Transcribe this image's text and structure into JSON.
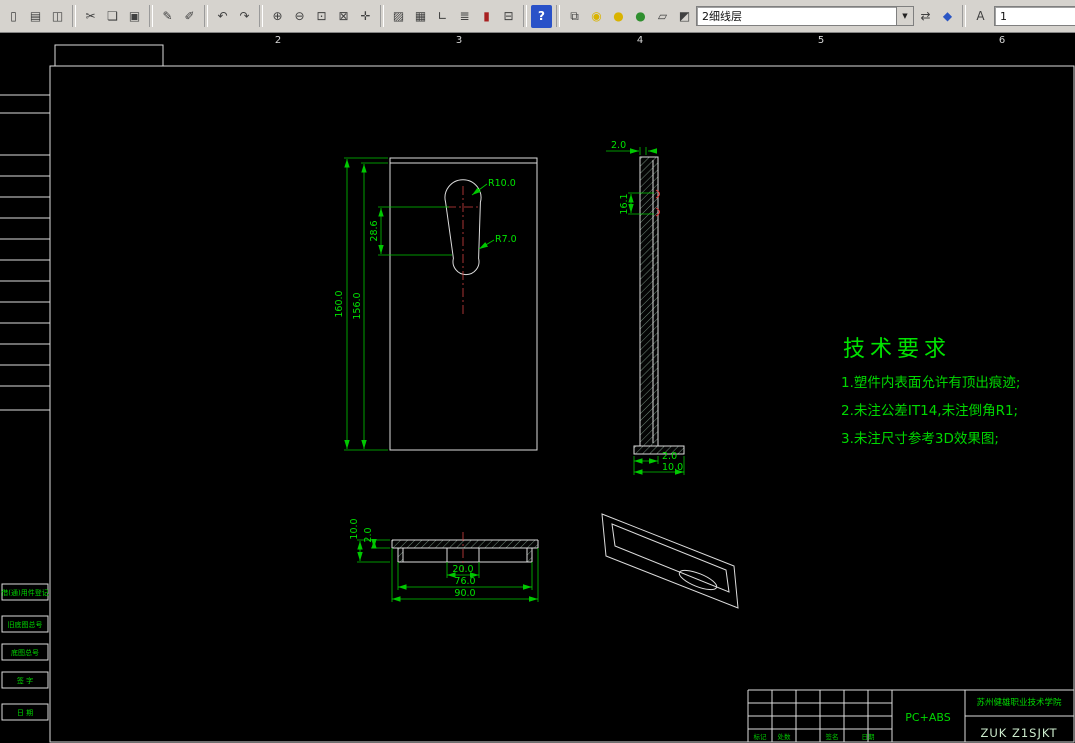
{
  "toolbar": {
    "dd_arrow": "▼",
    "layer_dropdown": {
      "value": "2细线层"
    },
    "style_dropdown": {
      "value": "1"
    },
    "icons": [
      {
        "n": "new",
        "g": "▯"
      },
      {
        "n": "print",
        "g": "▤"
      },
      {
        "n": "print-preview",
        "g": "◫"
      },
      {
        "n": "cut",
        "g": "✂"
      },
      {
        "n": "copy",
        "g": "❏"
      },
      {
        "n": "paste",
        "g": "▣"
      },
      {
        "n": "pencil",
        "g": "✎"
      },
      {
        "n": "pen",
        "g": "✐"
      },
      {
        "n": "undo",
        "g": "↶"
      },
      {
        "n": "redo",
        "g": "↷"
      },
      {
        "n": "zoom-in",
        "g": "⊕"
      },
      {
        "n": "zoom-out",
        "g": "⊖"
      },
      {
        "n": "zoom-window",
        "g": "⊡"
      },
      {
        "n": "zoom-all",
        "g": "⊠"
      },
      {
        "n": "pan",
        "g": "✛"
      },
      {
        "n": "hatch",
        "g": "▨"
      },
      {
        "n": "grid",
        "g": "▦"
      },
      {
        "n": "ortho",
        "g": "∟"
      },
      {
        "n": "layers",
        "g": "≣"
      },
      {
        "n": "standards-book",
        "g": "▮"
      },
      {
        "n": "table",
        "g": "⊟"
      },
      {
        "n": "help",
        "g": "?"
      },
      {
        "n": "sheets",
        "g": "⧉"
      },
      {
        "n": "bulb",
        "g": "◉"
      },
      {
        "n": "ball-yellow",
        "g": "●"
      },
      {
        "n": "ball-green",
        "g": "●"
      },
      {
        "n": "folder",
        "g": "▱"
      },
      {
        "n": "palette",
        "g": "◩"
      },
      {
        "n": "swap",
        "g": "⇄"
      },
      {
        "n": "droplet",
        "g": "◆"
      },
      {
        "n": "text-style",
        "g": "A"
      }
    ]
  },
  "zones": [
    "2",
    "3",
    "4",
    "5",
    "6"
  ],
  "margin_labels": [
    "借(通)用件登记",
    "旧底图总号",
    "底图总号",
    "签 字",
    "日 期"
  ],
  "front_view": {
    "h_outer": "160.0",
    "h_inner": "156.0",
    "slot_offset": "28.6",
    "r_top": "R10.0",
    "r_bottom": "R7.0"
  },
  "side_view": {
    "t_top": "2.0",
    "slot_len": "16.1",
    "t_bottom": "2.0",
    "foot_w": "10.0"
  },
  "bottom_view": {
    "depth": "10.0",
    "t_flange": "2.0",
    "slot_w": "20.0",
    "inner_w": "76.0",
    "outer_w": "90.0"
  },
  "tech_req": {
    "title": "技术要求",
    "items": [
      "1.塑件内表面允许有顶出痕迹;",
      "2.未注公差IT14,未注倒角R1;",
      "3.未注尺寸参考3D效果图;"
    ]
  },
  "title_block": {
    "material": "PC+ABS",
    "school": "苏州健雄职业技术学院",
    "part_no": "ZUK Z1SJKT",
    "cells": [
      "标记",
      "处数",
      "签名",
      "日期"
    ]
  }
}
